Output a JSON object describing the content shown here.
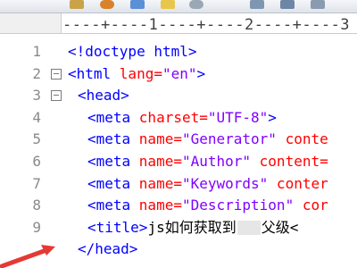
{
  "toolbar": {
    "icons": [
      "folder-icon",
      "globe-icon",
      "image-icon",
      "notes-icon",
      "settings-icon",
      "grid-icon",
      "table-icon",
      "format-icon"
    ]
  },
  "ruler": {
    "text": "----+----1----+----2----+----3"
  },
  "lines": [
    {
      "num": "1",
      "fold": false,
      "indent": 0,
      "parts": [
        {
          "t": "<!doctype html>",
          "c": "tag"
        }
      ]
    },
    {
      "num": "2",
      "fold": true,
      "indent": 0,
      "parts": [
        {
          "t": "<html ",
          "c": "tag"
        },
        {
          "t": "lang=",
          "c": "attr"
        },
        {
          "t": "\"en\"",
          "c": "val"
        },
        {
          "t": ">",
          "c": "tag"
        }
      ]
    },
    {
      "num": "3",
      "fold": true,
      "indent": 1,
      "parts": [
        {
          "t": "<head>",
          "c": "tag"
        }
      ]
    },
    {
      "num": "4",
      "fold": false,
      "indent": 2,
      "parts": [
        {
          "t": "<meta ",
          "c": "tag"
        },
        {
          "t": "charset=",
          "c": "attr"
        },
        {
          "t": "\"UTF-8\"",
          "c": "val"
        },
        {
          "t": ">",
          "c": "tag"
        }
      ]
    },
    {
      "num": "5",
      "fold": false,
      "indent": 2,
      "parts": [
        {
          "t": "<meta ",
          "c": "tag"
        },
        {
          "t": "name=",
          "c": "attr"
        },
        {
          "t": "\"Generator\"",
          "c": "val"
        },
        {
          "t": " conte",
          "c": "attr"
        }
      ]
    },
    {
      "num": "6",
      "fold": false,
      "indent": 2,
      "parts": [
        {
          "t": "<meta ",
          "c": "tag"
        },
        {
          "t": "name=",
          "c": "attr"
        },
        {
          "t": "\"Author\"",
          "c": "val"
        },
        {
          "t": " content=",
          "c": "attr"
        }
      ]
    },
    {
      "num": "7",
      "fold": false,
      "indent": 2,
      "parts": [
        {
          "t": "<meta ",
          "c": "tag"
        },
        {
          "t": "name=",
          "c": "attr"
        },
        {
          "t": "\"Keywords\"",
          "c": "val"
        },
        {
          "t": " conter",
          "c": "attr"
        }
      ]
    },
    {
      "num": "8",
      "fold": false,
      "indent": 2,
      "parts": [
        {
          "t": "<meta ",
          "c": "tag"
        },
        {
          "t": "name=",
          "c": "attr"
        },
        {
          "t": "\"Description\"",
          "c": "val"
        },
        {
          "t": " cor",
          "c": "attr"
        }
      ]
    },
    {
      "num": "9",
      "fold": false,
      "indent": 2,
      "parts": [
        {
          "t": "<title>",
          "c": "tag"
        },
        {
          "t": "js如何获取到",
          "c": "txt"
        },
        {
          "t": "",
          "c": "blur"
        },
        {
          "t": "父级<",
          "c": "txt"
        }
      ]
    },
    {
      "num": "",
      "fold": false,
      "indent": 1,
      "parts": [
        {
          "t": "</head>",
          "c": "tag"
        }
      ]
    }
  ]
}
